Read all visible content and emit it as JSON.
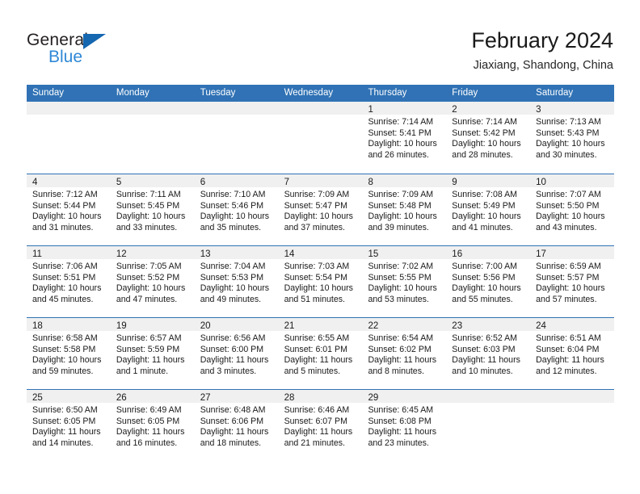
{
  "brand": {
    "name_part1": "General",
    "name_part2": "Blue",
    "triangle_color": "#1567b0",
    "blue_color": "#2f88d6"
  },
  "header": {
    "title": "February 2024",
    "subtitle": "Jiaxiang, Shandong, China"
  },
  "theme": {
    "header_blue": "#3072b5",
    "day_band_gray": "#f0f0f0",
    "text": "#1a1a1a"
  },
  "weekday_headers": [
    "Sunday",
    "Monday",
    "Tuesday",
    "Wednesday",
    "Thursday",
    "Friday",
    "Saturday"
  ],
  "weeks": [
    [
      {
        "day": "",
        "sunrise": "",
        "sunset": "",
        "daylight_line1": "",
        "daylight_line2": ""
      },
      {
        "day": "",
        "sunrise": "",
        "sunset": "",
        "daylight_line1": "",
        "daylight_line2": ""
      },
      {
        "day": "",
        "sunrise": "",
        "sunset": "",
        "daylight_line1": "",
        "daylight_line2": ""
      },
      {
        "day": "",
        "sunrise": "",
        "sunset": "",
        "daylight_line1": "",
        "daylight_line2": ""
      },
      {
        "day": "1",
        "sunrise": "Sunrise: 7:14 AM",
        "sunset": "Sunset: 5:41 PM",
        "daylight_line1": "Daylight: 10 hours",
        "daylight_line2": "and 26 minutes."
      },
      {
        "day": "2",
        "sunrise": "Sunrise: 7:14 AM",
        "sunset": "Sunset: 5:42 PM",
        "daylight_line1": "Daylight: 10 hours",
        "daylight_line2": "and 28 minutes."
      },
      {
        "day": "3",
        "sunrise": "Sunrise: 7:13 AM",
        "sunset": "Sunset: 5:43 PM",
        "daylight_line1": "Daylight: 10 hours",
        "daylight_line2": "and 30 minutes."
      }
    ],
    [
      {
        "day": "4",
        "sunrise": "Sunrise: 7:12 AM",
        "sunset": "Sunset: 5:44 PM",
        "daylight_line1": "Daylight: 10 hours",
        "daylight_line2": "and 31 minutes."
      },
      {
        "day": "5",
        "sunrise": "Sunrise: 7:11 AM",
        "sunset": "Sunset: 5:45 PM",
        "daylight_line1": "Daylight: 10 hours",
        "daylight_line2": "and 33 minutes."
      },
      {
        "day": "6",
        "sunrise": "Sunrise: 7:10 AM",
        "sunset": "Sunset: 5:46 PM",
        "daylight_line1": "Daylight: 10 hours",
        "daylight_line2": "and 35 minutes."
      },
      {
        "day": "7",
        "sunrise": "Sunrise: 7:09 AM",
        "sunset": "Sunset: 5:47 PM",
        "daylight_line1": "Daylight: 10 hours",
        "daylight_line2": "and 37 minutes."
      },
      {
        "day": "8",
        "sunrise": "Sunrise: 7:09 AM",
        "sunset": "Sunset: 5:48 PM",
        "daylight_line1": "Daylight: 10 hours",
        "daylight_line2": "and 39 minutes."
      },
      {
        "day": "9",
        "sunrise": "Sunrise: 7:08 AM",
        "sunset": "Sunset: 5:49 PM",
        "daylight_line1": "Daylight: 10 hours",
        "daylight_line2": "and 41 minutes."
      },
      {
        "day": "10",
        "sunrise": "Sunrise: 7:07 AM",
        "sunset": "Sunset: 5:50 PM",
        "daylight_line1": "Daylight: 10 hours",
        "daylight_line2": "and 43 minutes."
      }
    ],
    [
      {
        "day": "11",
        "sunrise": "Sunrise: 7:06 AM",
        "sunset": "Sunset: 5:51 PM",
        "daylight_line1": "Daylight: 10 hours",
        "daylight_line2": "and 45 minutes."
      },
      {
        "day": "12",
        "sunrise": "Sunrise: 7:05 AM",
        "sunset": "Sunset: 5:52 PM",
        "daylight_line1": "Daylight: 10 hours",
        "daylight_line2": "and 47 minutes."
      },
      {
        "day": "13",
        "sunrise": "Sunrise: 7:04 AM",
        "sunset": "Sunset: 5:53 PM",
        "daylight_line1": "Daylight: 10 hours",
        "daylight_line2": "and 49 minutes."
      },
      {
        "day": "14",
        "sunrise": "Sunrise: 7:03 AM",
        "sunset": "Sunset: 5:54 PM",
        "daylight_line1": "Daylight: 10 hours",
        "daylight_line2": "and 51 minutes."
      },
      {
        "day": "15",
        "sunrise": "Sunrise: 7:02 AM",
        "sunset": "Sunset: 5:55 PM",
        "daylight_line1": "Daylight: 10 hours",
        "daylight_line2": "and 53 minutes."
      },
      {
        "day": "16",
        "sunrise": "Sunrise: 7:00 AM",
        "sunset": "Sunset: 5:56 PM",
        "daylight_line1": "Daylight: 10 hours",
        "daylight_line2": "and 55 minutes."
      },
      {
        "day": "17",
        "sunrise": "Sunrise: 6:59 AM",
        "sunset": "Sunset: 5:57 PM",
        "daylight_line1": "Daylight: 10 hours",
        "daylight_line2": "and 57 minutes."
      }
    ],
    [
      {
        "day": "18",
        "sunrise": "Sunrise: 6:58 AM",
        "sunset": "Sunset: 5:58 PM",
        "daylight_line1": "Daylight: 10 hours",
        "daylight_line2": "and 59 minutes."
      },
      {
        "day": "19",
        "sunrise": "Sunrise: 6:57 AM",
        "sunset": "Sunset: 5:59 PM",
        "daylight_line1": "Daylight: 11 hours",
        "daylight_line2": "and 1 minute."
      },
      {
        "day": "20",
        "sunrise": "Sunrise: 6:56 AM",
        "sunset": "Sunset: 6:00 PM",
        "daylight_line1": "Daylight: 11 hours",
        "daylight_line2": "and 3 minutes."
      },
      {
        "day": "21",
        "sunrise": "Sunrise: 6:55 AM",
        "sunset": "Sunset: 6:01 PM",
        "daylight_line1": "Daylight: 11 hours",
        "daylight_line2": "and 5 minutes."
      },
      {
        "day": "22",
        "sunrise": "Sunrise: 6:54 AM",
        "sunset": "Sunset: 6:02 PM",
        "daylight_line1": "Daylight: 11 hours",
        "daylight_line2": "and 8 minutes."
      },
      {
        "day": "23",
        "sunrise": "Sunrise: 6:52 AM",
        "sunset": "Sunset: 6:03 PM",
        "daylight_line1": "Daylight: 11 hours",
        "daylight_line2": "and 10 minutes."
      },
      {
        "day": "24",
        "sunrise": "Sunrise: 6:51 AM",
        "sunset": "Sunset: 6:04 PM",
        "daylight_line1": "Daylight: 11 hours",
        "daylight_line2": "and 12 minutes."
      }
    ],
    [
      {
        "day": "25",
        "sunrise": "Sunrise: 6:50 AM",
        "sunset": "Sunset: 6:05 PM",
        "daylight_line1": "Daylight: 11 hours",
        "daylight_line2": "and 14 minutes."
      },
      {
        "day": "26",
        "sunrise": "Sunrise: 6:49 AM",
        "sunset": "Sunset: 6:05 PM",
        "daylight_line1": "Daylight: 11 hours",
        "daylight_line2": "and 16 minutes."
      },
      {
        "day": "27",
        "sunrise": "Sunrise: 6:48 AM",
        "sunset": "Sunset: 6:06 PM",
        "daylight_line1": "Daylight: 11 hours",
        "daylight_line2": "and 18 minutes."
      },
      {
        "day": "28",
        "sunrise": "Sunrise: 6:46 AM",
        "sunset": "Sunset: 6:07 PM",
        "daylight_line1": "Daylight: 11 hours",
        "daylight_line2": "and 21 minutes."
      },
      {
        "day": "29",
        "sunrise": "Sunrise: 6:45 AM",
        "sunset": "Sunset: 6:08 PM",
        "daylight_line1": "Daylight: 11 hours",
        "daylight_line2": "and 23 minutes."
      },
      {
        "day": "",
        "sunrise": "",
        "sunset": "",
        "daylight_line1": "",
        "daylight_line2": ""
      },
      {
        "day": "",
        "sunrise": "",
        "sunset": "",
        "daylight_line1": "",
        "daylight_line2": ""
      }
    ]
  ]
}
